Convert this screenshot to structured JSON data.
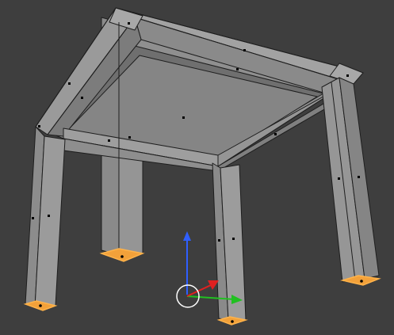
{
  "viewport": {
    "mode": "edit-mode-face-select",
    "object": "table-mesh",
    "selected_faces": [
      "leg-front-left-bottom",
      "leg-back-left-bottom",
      "leg-front-right-bottom",
      "leg-back-right-bottom"
    ]
  },
  "colors": {
    "background": "#3e3e3e",
    "face_light": "#9a9a9a",
    "face_mid": "#8c8c8c",
    "face_dark": "#7a7a7a",
    "face_underside": "#858585",
    "edge": "#1e1e1e",
    "selected_face": "#f2a13a",
    "selected_edge": "#ffb34a",
    "vertex_dot": "#000000",
    "gizmo_z": "#2f5fff",
    "gizmo_x": "#e02020",
    "gizmo_y": "#21c021",
    "gizmo_pivot": "#ffffff"
  },
  "icons": {
    "transform_gizmo": "translate-gizmo-icon",
    "pivot": "pivot-circle-icon"
  }
}
